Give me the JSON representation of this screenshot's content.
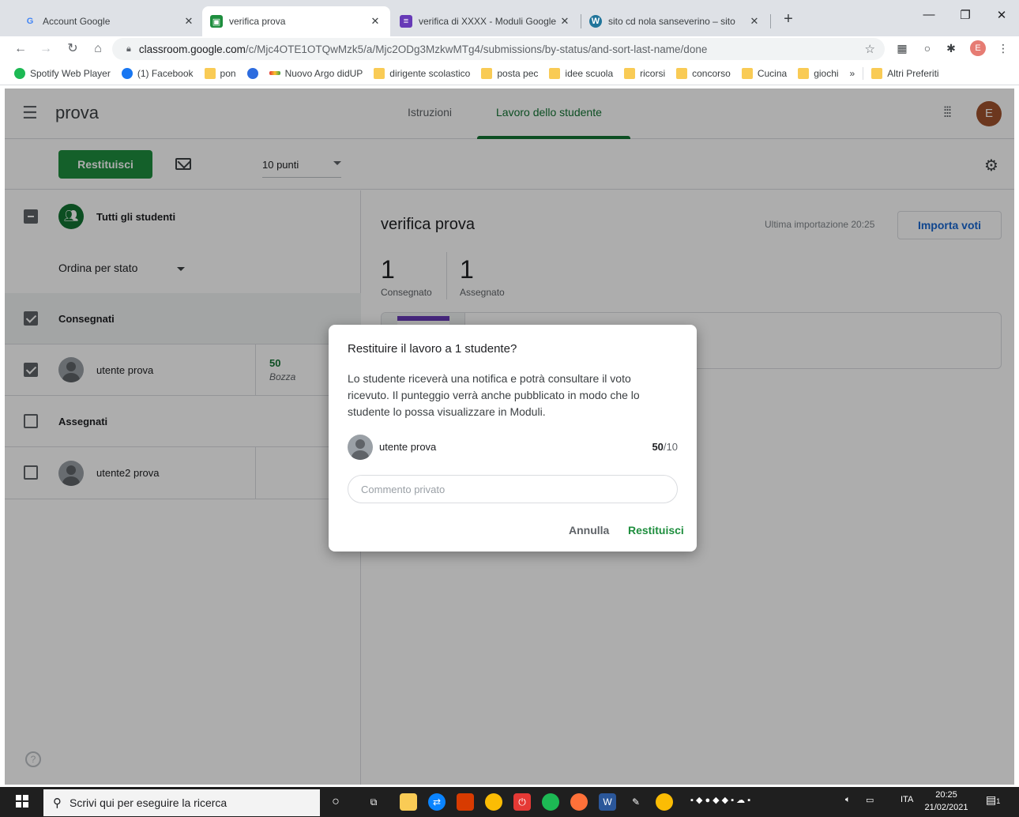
{
  "browser": {
    "tabs": [
      {
        "title": "Account Google",
        "icon": "google-g-icon"
      },
      {
        "title": "verifica prova",
        "icon": "classroom-icon"
      },
      {
        "title": "verifica di XXXX - Moduli Google",
        "icon": "forms-icon"
      },
      {
        "title": "sito cd nola sanseverino – sito",
        "icon": "wordpress-icon"
      }
    ],
    "url_domain": "classroom.google.com",
    "url_path": "/c/Mjc4OTE1OTQwMzk5/a/Mjc2ODg3MzkwMTg4/submissions/by-status/and-sort-last-name/done",
    "profile_initial": "E",
    "bookmarks": [
      {
        "label": "Spotify Web Player",
        "icon": "spotify-icon"
      },
      {
        "label": "(1) Facebook",
        "icon": "facebook-icon"
      },
      {
        "label": "pon",
        "icon": "folder-icon"
      },
      {
        "label": "",
        "icon": "cloud-icon"
      },
      {
        "label": "Nuovo Argo didUP",
        "icon": "argo-icon"
      },
      {
        "label": "dirigente scolastico",
        "icon": "folder-icon"
      },
      {
        "label": "posta pec",
        "icon": "folder-icon"
      },
      {
        "label": "idee scuola",
        "icon": "folder-icon"
      },
      {
        "label": "ricorsi",
        "icon": "folder-icon"
      },
      {
        "label": "concorso",
        "icon": "folder-icon"
      },
      {
        "label": "Cucina",
        "icon": "folder-icon"
      },
      {
        "label": "giochi",
        "icon": "folder-icon"
      }
    ],
    "bookmarks_more": "»",
    "other_bookmarks": "Altri Preferiti"
  },
  "classroom": {
    "class_name": "prova",
    "tabs": [
      "Istruzioni",
      "Lavoro dello studente"
    ],
    "user_initial": "E",
    "return_button": "Restituisci",
    "points_select": "10 punti",
    "all_students": "Tutti gli studenti",
    "sort_by": "Ordina per stato",
    "groups": {
      "turned_in": "Consegnati",
      "assigned": "Assegnati"
    },
    "students": [
      {
        "name": "utente prova",
        "grade": "50",
        "grade_status": "Bozza",
        "checked": true
      },
      {
        "name": "utente2 prova",
        "grade": "",
        "grade_status": "",
        "checked": false
      }
    ],
    "assignment": {
      "title": "verifica prova",
      "last_import": "Ultima importazione 20:25",
      "import_button": "Importa voti",
      "turned_in_count": "1",
      "turned_in_label": "Consegnato",
      "assigned_count": "1",
      "assigned_label": "Assegnato"
    }
  },
  "dialog": {
    "title": "Restituire il lavoro a 1 studente?",
    "body": "Lo studente riceverà una notifica e potrà consultare il voto ricevuto. Il punteggio verrà anche pubblicato in modo che lo studente lo possa visualizzare in Moduli.",
    "student_name": "utente prova",
    "grade_value": "50",
    "grade_max": "/10",
    "comment_placeholder": "Commento privato",
    "cancel_label": "Annulla",
    "confirm_label": "Restituisci"
  },
  "taskbar": {
    "search_placeholder": "Scrivi qui per eseguire la ricerca",
    "language": "ITA",
    "time": "20:25",
    "date": "21/02/2021",
    "notifications": "1"
  },
  "colors": {
    "accent_green": "#1e8e3e",
    "classroom_green": "#137333",
    "import_blue": "#1967d2"
  }
}
